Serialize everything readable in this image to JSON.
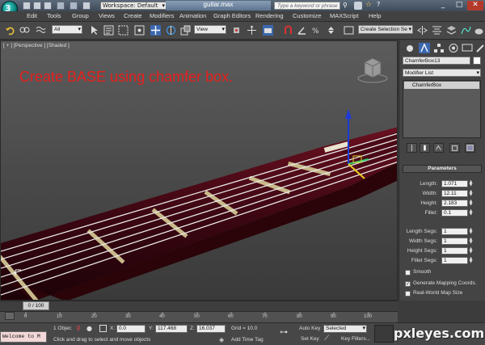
{
  "app": {
    "logo_letter": "3",
    "workspace": "Workspace: Default",
    "doc_title": "guitar.max",
    "search_placeholder": "Type a keyword or phrase",
    "window_buttons": [
      "_",
      "□",
      "✕"
    ]
  },
  "menu": [
    "Edit",
    "Tools",
    "Group",
    "Views",
    "Create",
    "Modifiers",
    "Animation",
    "Graph Editors",
    "Rendering",
    "Customize",
    "MAXScript",
    "Help"
  ],
  "toolbar": {
    "selection_filter": "All",
    "ref_coord": "View",
    "selection_set": "Create Selection Se"
  },
  "viewport": {
    "label": "[ + ] [Perspective ] [Shaded ]",
    "caption": "Create BASE using chamfer box."
  },
  "command_panel": {
    "object_name": "ChamferBox13",
    "modifier_list": "Modifier List",
    "stack_item": "ChamferBox",
    "rollout_title": "Parameters",
    "params": [
      {
        "label": "Length:",
        "value": "1.071"
      },
      {
        "label": "Width:",
        "value": "12.11"
      },
      {
        "label": "Height:",
        "value": "2.183"
      },
      {
        "label": "Fillet:",
        "value": "0.1"
      }
    ],
    "segs": [
      {
        "label": "Length Segs:",
        "value": "1"
      },
      {
        "label": "Width Segs:",
        "value": "1"
      },
      {
        "label": "Height Segs:",
        "value": "1"
      },
      {
        "label": "Fillet Segs:",
        "value": "1"
      }
    ],
    "checkboxes": [
      {
        "label": "Smooth",
        "checked": false
      },
      {
        "label": "Generate Mapping Coords.",
        "checked": true
      },
      {
        "label": "Real-World Map Size",
        "checked": false
      }
    ]
  },
  "timeline": {
    "frame": "0 / 100",
    "ticks": [
      "0",
      "10",
      "20",
      "30",
      "40",
      "50",
      "60",
      "70",
      "80",
      "90",
      "100"
    ]
  },
  "status": {
    "maxscript": "Welcome to M",
    "selection": "1 Objec",
    "x_label": "X:",
    "x_value": "0.0",
    "y_label": "Y:",
    "y_value": "117.468",
    "z_label": "Z:",
    "z_value": "16.037",
    "grid": "Grid = 10.0",
    "prompt": "Click and drag to select and move objects",
    "add_time_tag": "Add Time Tag",
    "auto_key": "Auto Key",
    "key_mode": "Selected",
    "set_key": "Set Key",
    "key_filters": "Key Filters...",
    "watermark": "pxleyes.com"
  }
}
